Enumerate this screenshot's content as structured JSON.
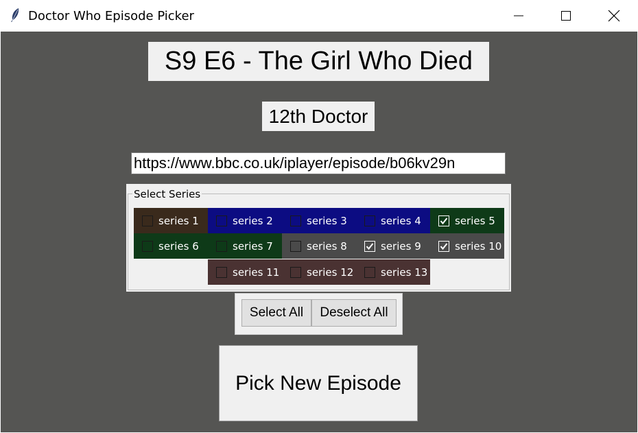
{
  "window": {
    "title": "Doctor Who Episode Picker"
  },
  "episode": {
    "title": "S9 E6 - The Girl Who Died",
    "doctor": "12th Doctor",
    "url": "https://www.bbc.co.uk/iplayer/episode/b06kv29n"
  },
  "series_frame": {
    "label": "Select Series",
    "series": [
      {
        "label": "series 1",
        "checked": false,
        "bg": "#3a2a1c"
      },
      {
        "label": "series 2",
        "checked": false,
        "bg": "#0c0c82"
      },
      {
        "label": "series 3",
        "checked": false,
        "bg": "#0c0c82"
      },
      {
        "label": "series 4",
        "checked": false,
        "bg": "#0c0c82"
      },
      {
        "label": "series 5",
        "checked": true,
        "bg": "#0e3a18"
      },
      {
        "label": "series 6",
        "checked": false,
        "bg": "#0e3a18"
      },
      {
        "label": "series 7",
        "checked": false,
        "bg": "#0e3a18"
      },
      {
        "label": "series 8",
        "checked": false,
        "bg": "#4a4a4a"
      },
      {
        "label": "series 9",
        "checked": true,
        "bg": "#4a4a4a"
      },
      {
        "label": "series 10",
        "checked": true,
        "bg": "#4a4a4a"
      },
      {
        "label": "series 11",
        "checked": false,
        "bg": "#4a3232"
      },
      {
        "label": "series 12",
        "checked": false,
        "bg": "#4a3232"
      },
      {
        "label": "series 13",
        "checked": false,
        "bg": "#4a3232"
      }
    ]
  },
  "buttons": {
    "select_all": "Select All",
    "deselect_all": "Deselect All",
    "pick": "Pick New Episode"
  },
  "icons": {
    "app": "feather-icon",
    "minimize": "minimize-icon",
    "maximize": "maximize-icon",
    "close": "close-icon"
  },
  "colors": {
    "background": "#555553",
    "panel": "#f0f0f0"
  }
}
